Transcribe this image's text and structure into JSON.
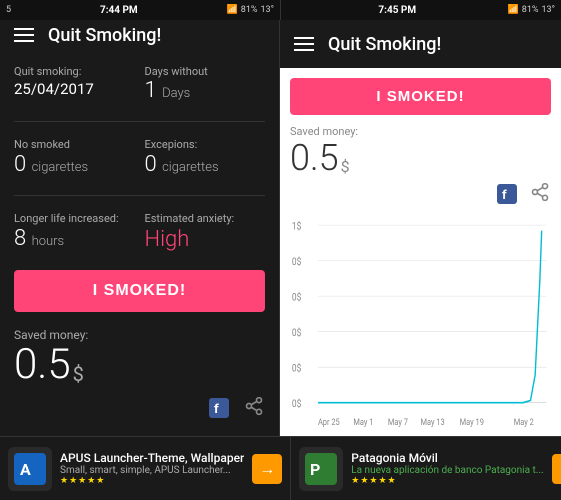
{
  "left_status": {
    "left_text": "5",
    "time": "7:44 PM",
    "battery": "81%",
    "right_icon": "13°"
  },
  "right_status": {
    "time": "7:45 PM",
    "battery": "81%",
    "right_icon": "13°"
  },
  "app": {
    "title": "Quit Smoking!"
  },
  "left_panel": {
    "quit_label": "Quit smoking:",
    "quit_date": "25/04/2017",
    "days_without_label": "Days without",
    "days_without_value": "1",
    "days_without_unit": "Days",
    "no_smoked_label": "No smoked",
    "no_smoked_value": "0",
    "no_smoked_unit": "cigarettes",
    "exceptions_label": "Excepions:",
    "exceptions_value": "0",
    "exceptions_unit": "cigarettes",
    "longer_life_label": "Longer life increased:",
    "longer_life_value": "8",
    "longer_life_unit": "hours",
    "anxiety_label": "Estimated anxiety:",
    "anxiety_value": "High",
    "smoked_btn": "I SMOKED!",
    "saved_money_label": "Saved money:",
    "saved_money_value": "0.5",
    "saved_money_currency": "$"
  },
  "right_panel": {
    "smoked_btn": "I SMOKED!",
    "saved_money_label": "Saved money:",
    "saved_money_value": "0.5",
    "saved_money_currency": "$"
  },
  "chart": {
    "y_labels": [
      "1$",
      "0$",
      "0$",
      "0$",
      "0$",
      "0$"
    ],
    "x_labels": [
      "Apr 25",
      "May 1",
      "May 7",
      "May 13",
      "May 19",
      "May 2"
    ]
  },
  "ads": {
    "left": {
      "title": "APUS Launcher-Theme, Wallpaper",
      "subtitle": "Small, smart, simple, APUS Launcher...",
      "stars": "★★★★★",
      "arrow": "→"
    },
    "right": {
      "title": "Patagonia Móvil",
      "subtitle": "La nueva aplicación de banco Patagonia t...",
      "stars": "★★★★★",
      "arrow": "→"
    }
  }
}
